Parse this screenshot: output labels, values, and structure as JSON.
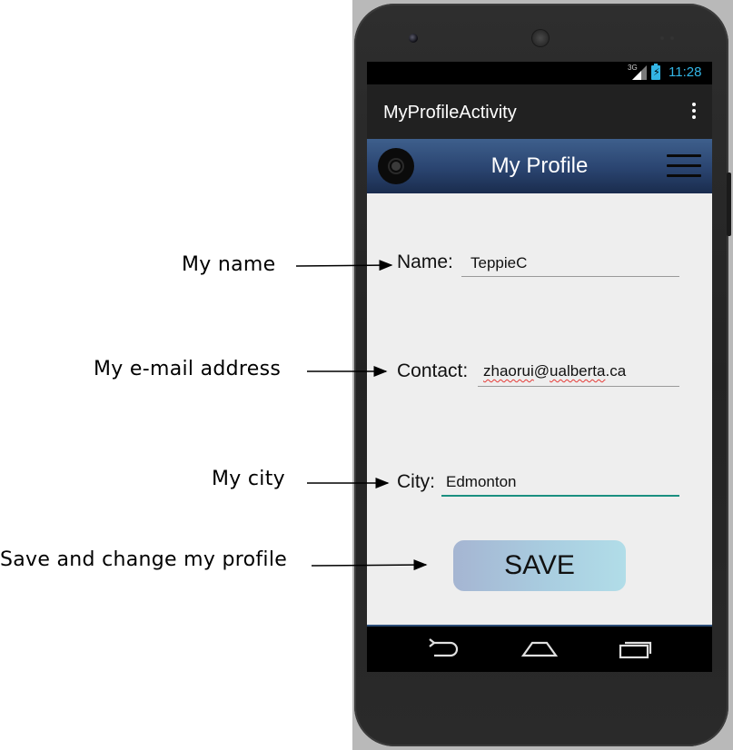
{
  "annotations": {
    "name_label": "My name",
    "email_label": "My e-mail address",
    "city_label": "My city",
    "save_label": "Save and change my profile"
  },
  "status_bar": {
    "network": "3G",
    "time": "11:28"
  },
  "action_bar": {
    "title": "MyProfileActivity"
  },
  "profile_header": {
    "title": "My Profile"
  },
  "form": {
    "name_label": "Name:",
    "name_value": "TeppieC",
    "contact_label": "Contact:",
    "contact_value": "zhaorui@ualberta.ca",
    "contact_user": "zhaorui",
    "contact_at": "@",
    "contact_domain_a": "ualberta",
    "contact_domain_b": ".ca",
    "city_label": "City:",
    "city_value": "Edmonton"
  },
  "save_button": {
    "label": "SAVE"
  },
  "icons": {
    "logo": "vinyl-disc-icon",
    "menu": "hamburger-menu-icon",
    "overflow": "overflow-menu-icon",
    "back": "back-icon",
    "home": "home-icon",
    "recents": "recent-apps-icon"
  },
  "colors": {
    "header_gradient_top": "#3e5f8c",
    "accent_blue": "#33b5e5",
    "focus_underline": "#1a8f80",
    "save_button": "#a9cde0"
  }
}
